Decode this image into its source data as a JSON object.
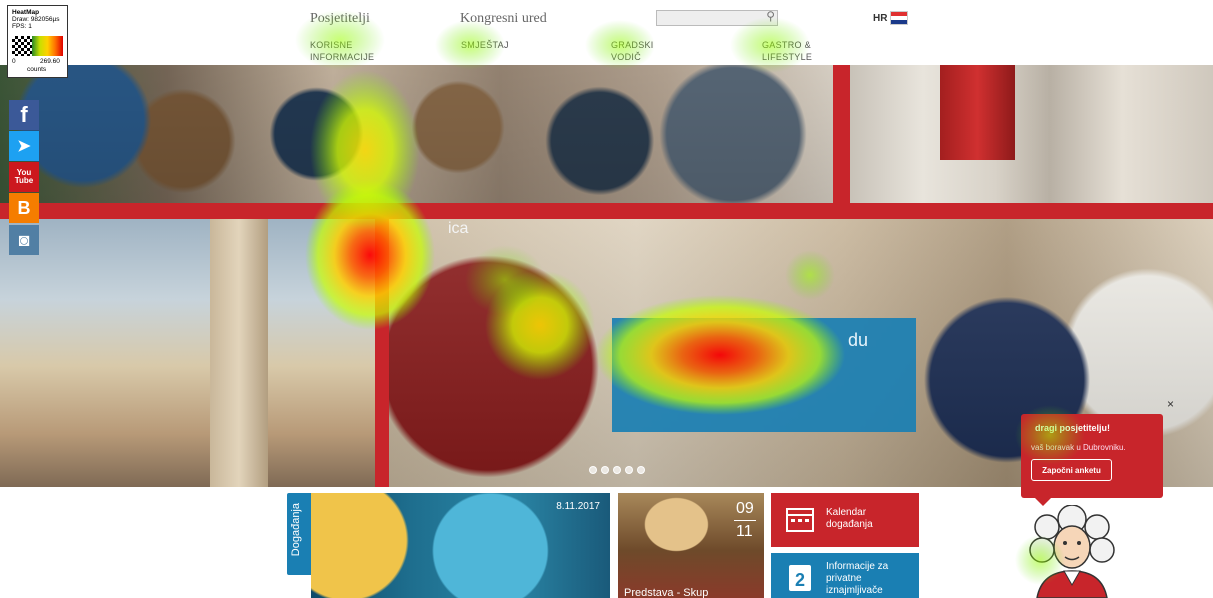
{
  "header": {
    "nav_top": [
      "Posjetitelji",
      "Kongresni ured"
    ],
    "nav_main": [
      "KORISNE INFORMACIJE",
      "SMJEŠTAJ",
      "GRADSKI VODIČ",
      "GASTRO & LIFESTYLE"
    ],
    "search_placeholder": "",
    "language": "HR"
  },
  "social_bar": {
    "items": [
      {
        "icon": "facebook-icon",
        "glyph": "f",
        "color": "#3b5998"
      },
      {
        "icon": "twitter-icon",
        "glyph": "🐦",
        "color": "#1da1f2"
      },
      {
        "icon": "youtube-icon",
        "glyph": "You Tube",
        "color": "#cc181e"
      },
      {
        "icon": "blogger-icon",
        "glyph": "B",
        "color": "#f57d00"
      },
      {
        "icon": "instagram-icon",
        "glyph": "◉",
        "color": "#517fa4"
      }
    ]
  },
  "slider": {
    "caption_fragment_top": "ica",
    "caption_fragment": "du",
    "dot_count": 5
  },
  "survey": {
    "title": "dragi posjetitelju!",
    "text": "vaš boravak u Dubrovniku.",
    "button": "Započni anketu",
    "close": "×"
  },
  "tiles": {
    "events_tab": "Događanja",
    "waterpolo_date": "8.11.2017",
    "theatre_day": "09",
    "theatre_month": "11",
    "theatre_caption": "Predstava - Skup",
    "calendar_label": "Kalendar događanja",
    "info_label": "Informacije za privatne iznajmljivače"
  },
  "heatmap_legend": {
    "title": "HeatMap",
    "draw": "Draw: 982056µs",
    "fps": "FPS: 1",
    "min": "0",
    "max": "269.60",
    "unit": "counts"
  },
  "colors": {
    "brand_red": "#c8252b",
    "brand_blue": "#1a7fb3"
  }
}
